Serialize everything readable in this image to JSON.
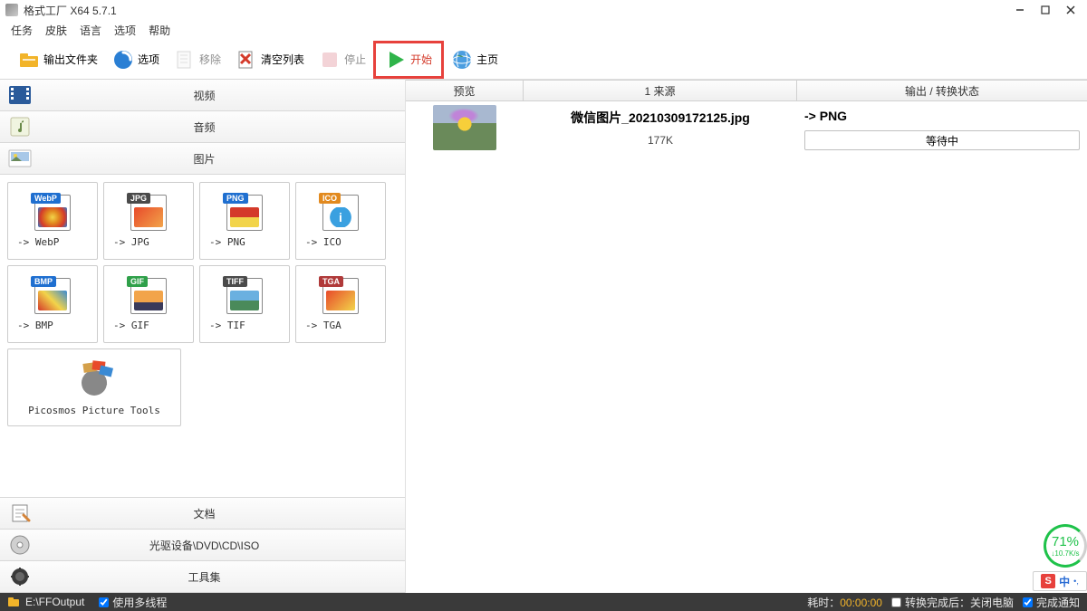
{
  "window": {
    "title": "格式工厂 X64 5.7.1"
  },
  "menu": {
    "task": "任务",
    "skin": "皮肤",
    "lang": "语言",
    "option": "选项",
    "help": "帮助"
  },
  "toolbar": {
    "output_folder": "输出文件夹",
    "options": "选项",
    "remove": "移除",
    "clear": "清空列表",
    "stop": "停止",
    "start": "开始",
    "home": "主页"
  },
  "categories": {
    "video": "视频",
    "audio": "音频",
    "image": "图片",
    "doc": "文档",
    "disc": "光驱设备\\DVD\\CD\\ISO",
    "tools": "工具集"
  },
  "formats": {
    "webp": {
      "label": "-> WebP",
      "badge": "WebP",
      "badgeColor": "#1f6fd0"
    },
    "jpg": {
      "label": "-> JPG",
      "badge": "JPG",
      "badgeColor": "#4a4a4a"
    },
    "png": {
      "label": "-> PNG",
      "badge": "PNG",
      "badgeColor": "#1f6fd0"
    },
    "ico": {
      "label": "-> ICO",
      "badge": "ICO",
      "badgeColor": "#e28a1f"
    },
    "bmp": {
      "label": "-> BMP",
      "badge": "BMP",
      "badgeColor": "#1f6fd0"
    },
    "gif": {
      "label": "-> GIF",
      "badge": "GIF",
      "badgeColor": "#2fa04a"
    },
    "tif": {
      "label": "-> TIF",
      "badge": "TIFF",
      "badgeColor": "#4a4a4a"
    },
    "tga": {
      "label": "-> TGA",
      "badge": "TGA",
      "badgeColor": "#b03a3a"
    },
    "picosmos": {
      "label": "Picosmos Picture Tools"
    }
  },
  "table": {
    "headers": {
      "preview": "预览",
      "source": "1 来源",
      "output": "输出 / 转换状态"
    },
    "rows": [
      {
        "filename": "微信图片_20210309172125.jpg",
        "size": "177K",
        "target": "-> PNG",
        "status": "等待中"
      }
    ]
  },
  "statusbar": {
    "output_path": "E:\\FFOutput",
    "multithread": "使用多线程",
    "elapsed_label": "耗时：",
    "elapsed_value": "00:00:00",
    "close_after": "转换完成后：关闭电脑",
    "notify": "完成通知"
  },
  "widgets": {
    "speed_pct": "71%",
    "speed_rate": "↓10.7K/s",
    "ime_logo": "S",
    "ime_lang": "中"
  }
}
